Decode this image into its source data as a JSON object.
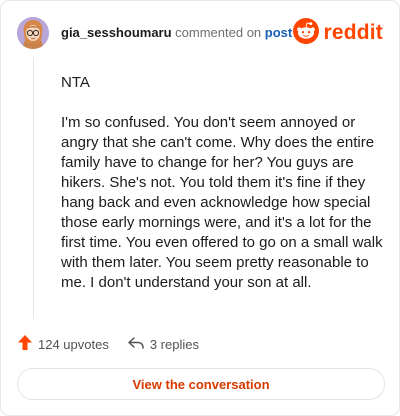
{
  "comment": {
    "username": "gia_sesshoumaru",
    "action_text": "commented on",
    "target_text": "post",
    "paragraphs": [
      "NTA",
      "I'm so confused. You don't seem annoyed or angry that she can't come. Why does the entire family have to change for her? You guys are hikers. She's not. You told them it's fine if they hang back and even acknowledge how special those early mornings were, and it's a lot for the first time. You even offered to go on a small walk with them later. You seem pretty reasonable to me. I don't understand your son at all."
    ]
  },
  "brand": {
    "name": "reddit",
    "icon": "reddit-snoo-icon",
    "color": "#ff4500"
  },
  "footer": {
    "upvotes_label": "124 upvotes",
    "replies_label": "3 replies",
    "upvote_icon": "upvote-arrow-icon",
    "reply_icon": "reply-arrow-icon",
    "upvote_color": "#ff4500"
  },
  "cta": {
    "label": "View the conversation"
  }
}
